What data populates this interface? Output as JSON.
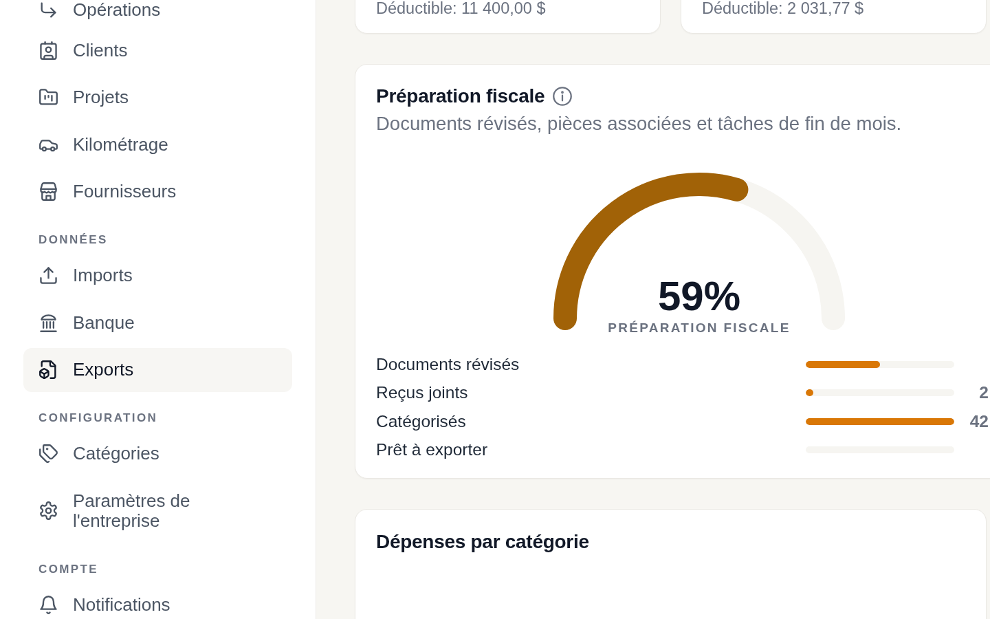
{
  "sidebar": {
    "sections": [
      {
        "items": [
          {
            "label": "Opérations",
            "selected": false
          },
          {
            "label": "Clients",
            "selected": false
          },
          {
            "label": "Projets",
            "selected": false
          },
          {
            "label": "Kilométrage",
            "selected": false
          },
          {
            "label": "Fournisseurs",
            "selected": false
          }
        ]
      },
      {
        "heading": "DONNÉES",
        "items": [
          {
            "label": "Imports",
            "selected": false
          },
          {
            "label": "Banque",
            "selected": false
          },
          {
            "label": "Exports",
            "selected": true
          }
        ]
      },
      {
        "heading": "CONFIGURATION",
        "items": [
          {
            "label": "Catégories",
            "selected": false
          },
          {
            "label": "Paramètres de l'entreprise",
            "selected": false
          }
        ]
      },
      {
        "heading": "COMPTE",
        "items": [
          {
            "label": "Notifications",
            "selected": false
          }
        ]
      }
    ]
  },
  "summary_cards": [
    {
      "caption": "Déductible: 11 400,00 $"
    },
    {
      "caption": "Déductible: 2 031,77 $"
    }
  ],
  "tax_preparation": {
    "title": "Préparation fiscale",
    "subtitle": "Documents révisés, pièces associées et tâches de fin de mois.",
    "gauge": {
      "level": 0.59,
      "value": "59%",
      "label": "PRÉPARATION FISCALE"
    },
    "rows": [
      {
        "label": "Documents révisés",
        "level": 0.5
      },
      {
        "label": "Reçus joints",
        "level": 0.05,
        "value": "2"
      },
      {
        "label": "Catégorisés",
        "level": 1,
        "value": "42"
      },
      {
        "label": "Prêt à exporter",
        "level": 0
      }
    ]
  },
  "expenses_by_category": {
    "title": "Dépenses par catégorie"
  }
}
